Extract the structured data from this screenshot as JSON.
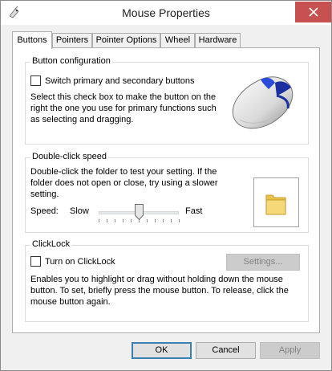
{
  "window": {
    "title": "Mouse Properties"
  },
  "tabs": [
    {
      "label": "Buttons"
    },
    {
      "label": "Pointers"
    },
    {
      "label": "Pointer Options"
    },
    {
      "label": "Wheel"
    },
    {
      "label": "Hardware"
    }
  ],
  "button_configuration": {
    "title": "Button configuration",
    "checkbox_label": "Switch primary and secondary buttons",
    "checked": false,
    "description_line1": "Select this check box to make the button on the",
    "description_line2": "right the one you use for primary functions such",
    "description_line3": "as selecting and dragging."
  },
  "double_click_speed": {
    "title": "Double-click speed",
    "description_line1": "Double-click the folder to test your setting. If the",
    "description_line2": "folder does not open or close, try using a slower",
    "description_line3": "setting.",
    "speed_label": "Speed:",
    "slow_label": "Slow",
    "fast_label": "Fast",
    "speed_value_fraction": 0.5
  },
  "clicklock": {
    "title": "ClickLock",
    "checkbox_label": "Turn on ClickLock",
    "checked": false,
    "settings_button": "Settings...",
    "description_line1": "Enables you to highlight or drag without holding down the mouse",
    "description_line2": "button. To set, briefly press the mouse button. To release, click the",
    "description_line3": "mouse button again."
  },
  "footer": {
    "ok": "OK",
    "cancel": "Cancel",
    "apply": "Apply"
  },
  "colors": {
    "close": "#c75050",
    "accent": "#3c7fb1"
  }
}
